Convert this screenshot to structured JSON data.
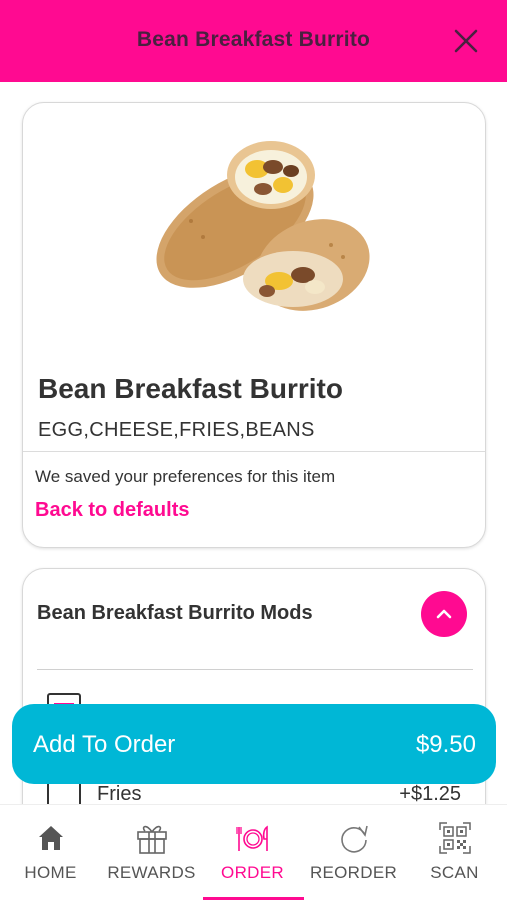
{
  "header": {
    "title": "Bean Breakfast Burrito",
    "close_icon": "close-icon"
  },
  "product": {
    "name": "Bean Breakfast Burrito",
    "description": "EGG,CHEESE,FRIES,BEANS",
    "preferences_text": "We saved your preferences for this item",
    "back_to_defaults": "Back to defaults"
  },
  "mods": {
    "title": "Bean Breakfast Burrito Mods",
    "items": [
      {
        "name": "",
        "price": "",
        "checked": true
      },
      {
        "name": "Fries",
        "price": "+$1.25",
        "checked": false
      }
    ]
  },
  "add_to_order": {
    "label": "Add To Order",
    "price": "$9.50"
  },
  "tabs": [
    {
      "label": "HOME",
      "icon": "home-icon"
    },
    {
      "label": "REWARDS",
      "icon": "gift-icon"
    },
    {
      "label": "ORDER",
      "icon": "plate-cutlery-icon",
      "active": true
    },
    {
      "label": "REORDER",
      "icon": "refresh-icon"
    },
    {
      "label": "SCAN",
      "icon": "qr-code-icon"
    }
  ],
  "colors": {
    "brand_pink": "#ff0a91",
    "accent_cyan": "#00b7d6",
    "header_text": "#4a2040"
  }
}
